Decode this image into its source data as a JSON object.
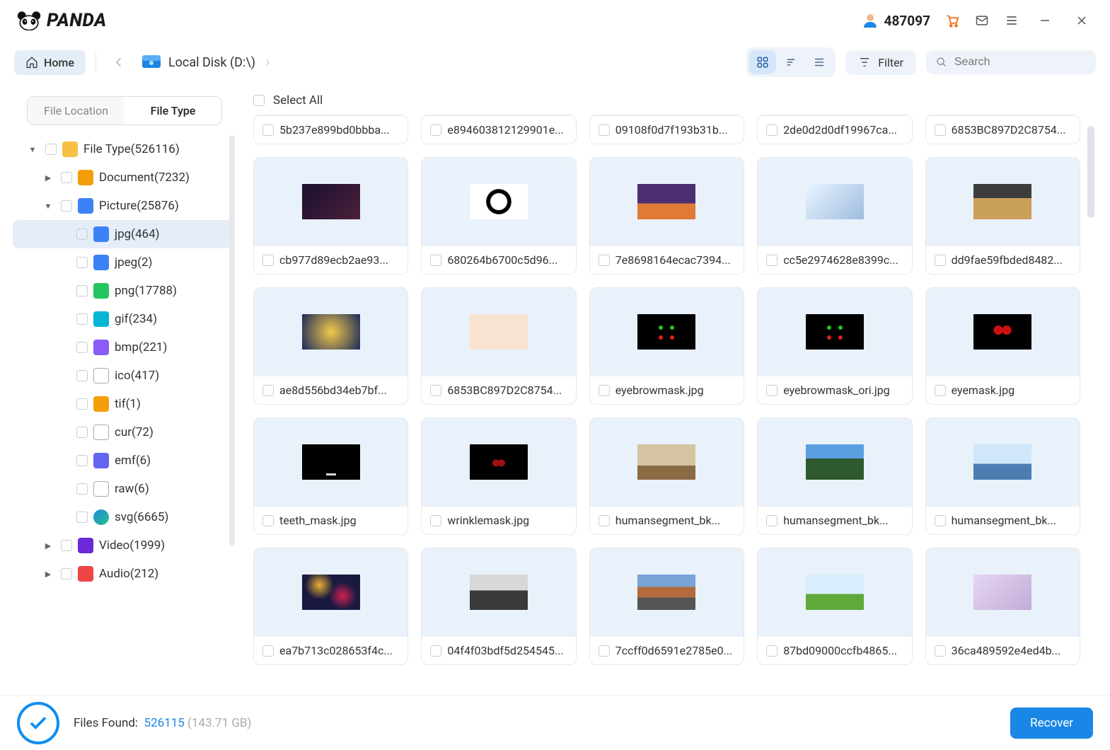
{
  "app": {
    "brand": "PANDA"
  },
  "titlebar": {
    "user_id": "487097"
  },
  "toolbar": {
    "home_label": "Home",
    "breadcrumb": "Local Disk (D:\\)",
    "filter_label": "Filter",
    "search_placeholder": "Search"
  },
  "sidebar": {
    "tabs": {
      "location": "File Location",
      "type": "File Type"
    },
    "tree": {
      "root": "File Type(526116)",
      "document": "Document(7232)",
      "picture": "Picture(25876)",
      "jpg": "jpg(464)",
      "jpeg": "jpeg(2)",
      "png": "png(17788)",
      "gif": "gif(234)",
      "bmp": "bmp(221)",
      "ico": "ico(417)",
      "tif": "tif(1)",
      "cur": "cur(72)",
      "emf": "emf(6)",
      "raw": "raw(6)",
      "svg": "svg(6665)",
      "video": "Video(1999)",
      "audio": "Audio(212)"
    }
  },
  "main": {
    "select_all": "Select All",
    "items": [
      {
        "name": "5b237e899bd0bbba...",
        "thumb": "stub"
      },
      {
        "name": "e894603812129901e...",
        "thumb": "stub"
      },
      {
        "name": "09108f0d7f193b31b...",
        "thumb": "stub"
      },
      {
        "name": "2de0d2d0df19967ca...",
        "thumb": "stub"
      },
      {
        "name": "6853BC897D2C8754...",
        "thumb": "stub"
      },
      {
        "name": "cb977d89ecb2ae93...",
        "thumb": "th-dark"
      },
      {
        "name": "680264b6700c5d96...",
        "thumb": "th-eye"
      },
      {
        "name": "7e8698164ecac7394...",
        "thumb": "th-city"
      },
      {
        "name": "cc5e2974628e8399c...",
        "thumb": "th-anime"
      },
      {
        "name": "dd9fae59fbded8482...",
        "thumb": "th-sunset"
      },
      {
        "name": "ae8d556bd34eb7bf...",
        "thumb": "th-paint"
      },
      {
        "name": "6853BC897D2C8754...",
        "thumb": "th-note"
      },
      {
        "name": "eyebrowmask.jpg",
        "thumb": "th-blk"
      },
      {
        "name": "eyebrowmask_ori.jpg",
        "thumb": "th-blk"
      },
      {
        "name": "eyemask.jpg",
        "thumb": "th-mask"
      },
      {
        "name": "teeth_mask.jpg",
        "thumb": "th-teeth"
      },
      {
        "name": "wrinklemask.jpg",
        "thumb": "th-wrink"
      },
      {
        "name": "humansegment_bk...",
        "thumb": "th-room"
      },
      {
        "name": "humansegment_bk...",
        "thumb": "th-mtn"
      },
      {
        "name": "humansegment_bk...",
        "thumb": "th-sea"
      },
      {
        "name": "ea7b713c028653f4c...",
        "thumb": "th-mix"
      },
      {
        "name": "04f4f03bdf5d254545...",
        "thumb": "th-whale"
      },
      {
        "name": "7ccff0d6591e2785e0...",
        "thumb": "th-road"
      },
      {
        "name": "87bd09000ccfb4865...",
        "thumb": "th-field"
      },
      {
        "name": "36ca489592e4ed4b...",
        "thumb": "th-fant"
      }
    ]
  },
  "footer": {
    "label": "Files Found:",
    "count": "526115",
    "size": "(143.71 GB)",
    "recover": "Recover"
  }
}
